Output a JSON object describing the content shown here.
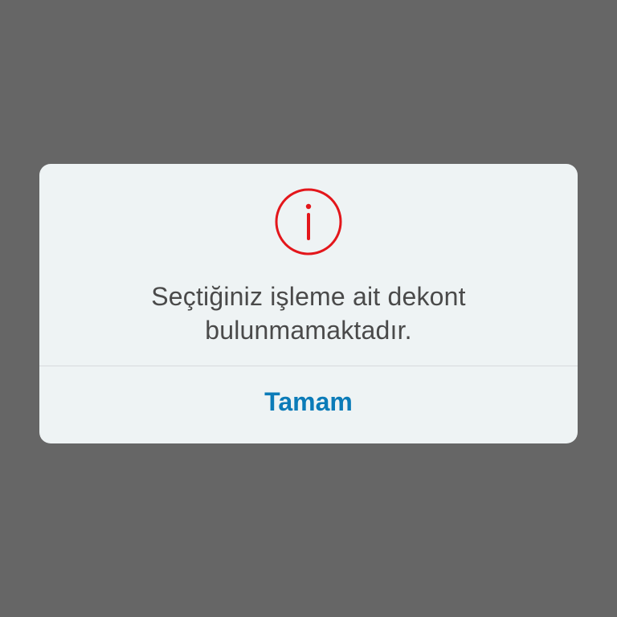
{
  "dialog": {
    "icon": "info-icon",
    "icon_color": "#e3161b",
    "message_line1": "Seçtiğiniz işleme ait dekont",
    "message_line2": "bulunmamaktadır.",
    "ok_label": "Tamam",
    "accent_color": "#0b7bb8"
  }
}
